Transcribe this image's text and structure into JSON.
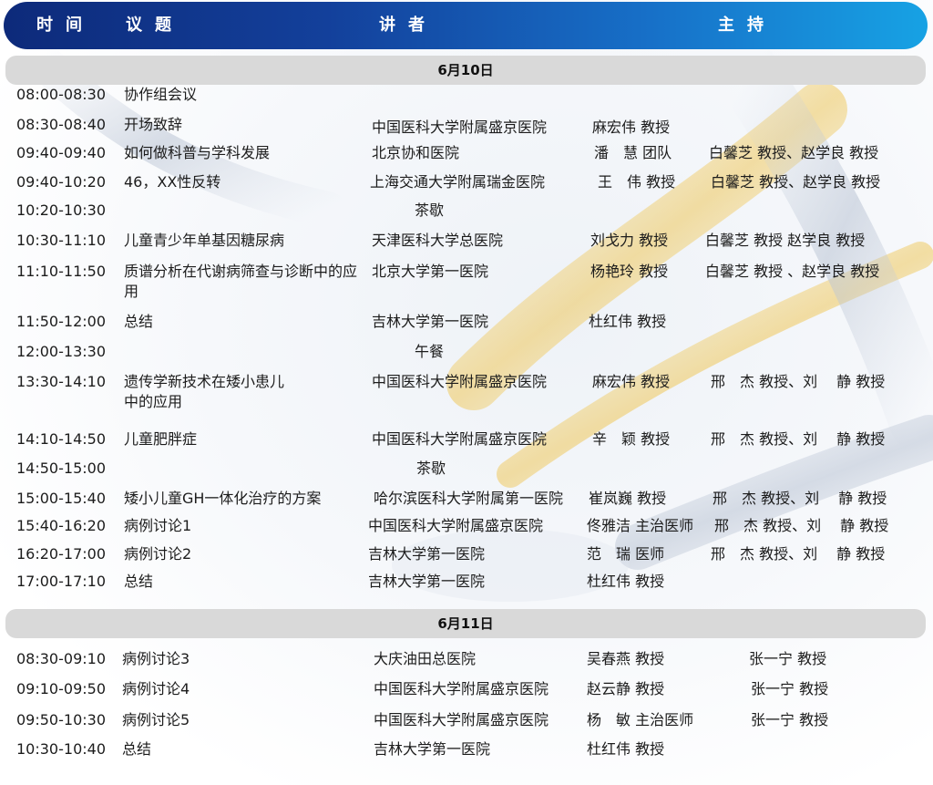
{
  "header": {
    "time": "时间",
    "topic": "议题",
    "speaker": "讲者",
    "host": "主持"
  },
  "days": [
    {
      "date": "6月10日",
      "rows": [
        {
          "time": "08:00-08:30",
          "topic": "协作组会议",
          "institution": "",
          "speaker": "",
          "host": ""
        },
        {
          "time": "08:30-08:40",
          "topic": "开场致辞",
          "institution": "中国医科大学附属盛京医院",
          "speaker": "麻宏伟 教授",
          "host": ""
        },
        {
          "time": "09:40-09:40",
          "topic": "如何做科普与学科发展",
          "institution": "北京协和医院",
          "speaker": "潘　慧 团队",
          "host": "白馨芝  教授、赵学良  教授"
        },
        {
          "time": "09:40-10:20",
          "topic": "46，XX性反转",
          "institution": "上海交通大学附属瑞金医院",
          "speaker": "王　伟  教授",
          "host": "白馨芝  教授、赵学良  教授"
        },
        {
          "time": "10:20-10:30",
          "topic": "",
          "institution": "茶歇",
          "speaker": "",
          "host": ""
        },
        {
          "time": "10:30-11:10",
          "topic": "儿童青少年单基因糖尿病",
          "institution": "天津医科大学总医院",
          "speaker": "刘戈力 教授",
          "host": "白馨芝  教授    赵学良  教授"
        },
        {
          "time": "11:10-11:50",
          "topic": "质谱分析在代谢病筛查与诊断中的应用",
          "institution": "北京大学第一医院",
          "speaker": "杨艳玲 教授",
          "host": "白馨芝  教授 、赵学良  教授"
        },
        {
          "time": "11:50-12:00",
          "topic": "总结",
          "institution": "吉林大学第一医院",
          "speaker": "杜红伟 教授",
          "host": ""
        },
        {
          "time": "12:00-13:30",
          "topic": "",
          "institution": "午餐",
          "speaker": "",
          "host": ""
        },
        {
          "time": "13:30-14:10",
          "topic": "遗传学新技术在矮小患儿中的应用",
          "institution": "中国医科大学附属盛京医院",
          "speaker": "麻宏伟 教授",
          "host": "邢　杰 教授、刘　 静  教授"
        },
        {
          "time": "14:10-14:50",
          "topic": "儿童肥胖症",
          "institution": "中国医科大学附属盛京医院",
          "speaker": "辛　颖 教授",
          "host": "邢　杰 教授、刘　 静  教授"
        },
        {
          "time": "14:50-15:00",
          "topic": "",
          "institution": "茶歇",
          "speaker": "",
          "host": ""
        },
        {
          "time": "15:00-15:40",
          "topic": "矮小儿童GH一体化治疗的方案",
          "institution": "哈尔滨医科大学附属第一医院",
          "speaker": "崔岚巍 教授",
          "host": "邢　杰  教授、刘　 静 教授"
        },
        {
          "time": "15:40-16:20",
          "topic": "病例讨论1",
          "institution": "中国医科大学附属盛京医院",
          "speaker": "佟雅洁 主治医师",
          "host": "邢　杰  教授、刘　 静 教授"
        },
        {
          "time": "16:20-17:00",
          "topic": "病例讨论2",
          "institution": "吉林大学第一医院",
          "speaker": "范　瑞  医师",
          "host": "邢　杰  教授、刘　 静 教授"
        },
        {
          "time": "17:00-17:10",
          "topic": "总结",
          "institution": "吉林大学第一医院",
          "speaker": "杜红伟 教授",
          "host": ""
        }
      ]
    },
    {
      "date": "6月11日",
      "rows": [
        {
          "time": "08:30-09:10",
          "topic": "病例讨论3",
          "institution": "大庆油田总医院",
          "speaker": "吴春燕  教授",
          "host": "张一宁  教授"
        },
        {
          "time": "09:10-09:50",
          "topic": "病例讨论4",
          "institution": "中国医科大学附属盛京医院",
          "speaker": "赵云静  教授",
          "host": "张一宁  教授"
        },
        {
          "time": "09:50-10:30",
          "topic": "病例讨论5",
          "institution": "中国医科大学附属盛京医院",
          "speaker": "杨　敏  主治医师",
          "host": "张一宁  教授"
        },
        {
          "time": "10:30-10:40",
          "topic": "总结",
          "institution": "吉林大学第一医院",
          "speaker": "杜红伟  教授",
          "host": ""
        }
      ]
    }
  ]
}
